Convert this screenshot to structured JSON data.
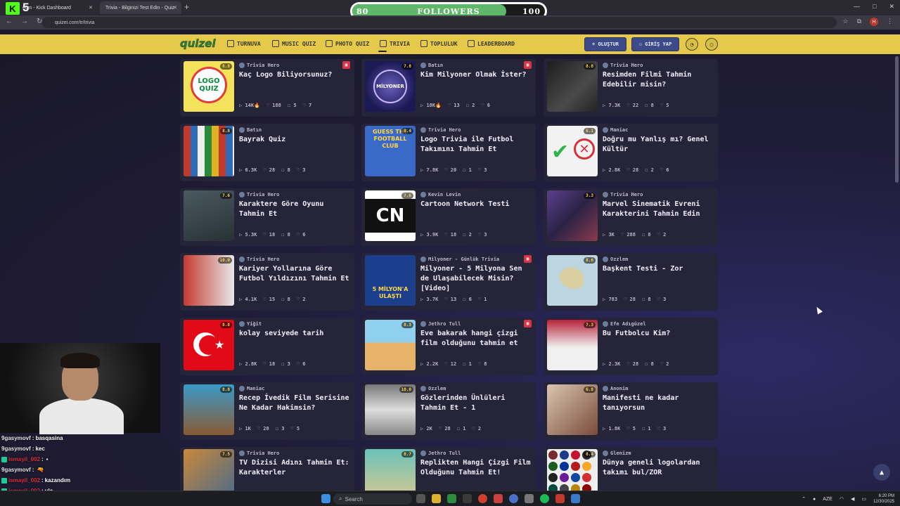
{
  "browser": {
    "tabs": [
      {
        "title": "Kick Dashboard",
        "prefix": "com - "
      },
      {
        "title": "Trivia - Bilginizi Test Edin - Quiz"
      }
    ],
    "new_tab": "+",
    "url": "quizei.com/tr/trivia",
    "profile_initial": "H",
    "window_controls": [
      "—",
      "□",
      "✕"
    ]
  },
  "overlay": {
    "kick_count": "5",
    "followers_label": "FOLLOWERS",
    "followers_current": "80",
    "followers_goal": "100",
    "followers_progress": 0.8
  },
  "site": {
    "logo": "quizei",
    "nav": [
      {
        "label": "TURNUVA",
        "icon": "trophy-icon"
      },
      {
        "label": "MUSIC QUIZ",
        "icon": "music-icon"
      },
      {
        "label": "PHOTO QUIZ",
        "icon": "photo-icon"
      },
      {
        "label": "TRIVIA",
        "icon": "lightbulb-icon"
      },
      {
        "label": "TOPLULUK",
        "icon": "users-icon"
      },
      {
        "label": "LEADERBOARD",
        "icon": "medal-icon"
      }
    ],
    "create_label": "+ OLUŞTUR",
    "login_label": "GİRİŞ YAP"
  },
  "cards": [
    {
      "author": "Trivia Hero",
      "title": "Kaç Logo Biliyorsunuz?",
      "rating": "8.8",
      "stats": [
        "14K",
        "188",
        "5",
        "7"
      ],
      "hot": true,
      "badge": true,
      "thumb_text": "LOGO QUIZ"
    },
    {
      "author": "Batın",
      "title": "Kim Milyoner Olmak İster?",
      "rating": "7.8",
      "stats": [
        "18K",
        "13",
        "2",
        "6"
      ],
      "hot": true,
      "badge": true,
      "thumb_text": "MİLYONER"
    },
    {
      "author": "Trivia Hero",
      "title": "Resimden Filmi Tahmin Edebilir misin?",
      "rating": "8.8",
      "stats": [
        "7.3K",
        "22",
        "8",
        "5"
      ],
      "hot": false,
      "badge": false
    },
    {
      "author": "Batın",
      "title": "Bayrak Quiz",
      "rating": "8.8",
      "stats": [
        "6.3K",
        "28",
        "8",
        "3"
      ],
      "hot": false,
      "badge": false
    },
    {
      "author": "Trivia Hero",
      "title": "Logo Trivia ile Futbol Takımını Tahmin Et",
      "rating": "8.4",
      "stats": [
        "7.8K",
        "20",
        "1",
        "3"
      ],
      "hot": false,
      "badge": false,
      "thumb_text": "GUESS THE FOOTBALL CLUB"
    },
    {
      "author": "Maniac",
      "title": "Doğru mu Yanlış mı? Genel Kültür",
      "rating": "6.1",
      "stats": [
        "2.8K",
        "28",
        "2",
        "6"
      ],
      "hot": false,
      "badge": false
    },
    {
      "author": "Trivia Hero",
      "title": "Karaktere Göre Oyunu Tahmin Et",
      "rating": "7.6",
      "stats": [
        "5.3K",
        "18",
        "8",
        "6"
      ],
      "hot": false,
      "badge": false
    },
    {
      "author": "Kevin Levin",
      "title": "Cartoon Network Testi",
      "rating": "7.6",
      "stats": [
        "3.9K",
        "18",
        "2",
        "3"
      ],
      "hot": false,
      "badge": false,
      "thumb_text": "CN"
    },
    {
      "author": "Trivia Hero",
      "title": "Marvel Sinematik Evreni Karakterini Tahmin Edin",
      "rating": "3.3",
      "stats": [
        "3K",
        "288",
        "8",
        "2"
      ],
      "hot": false,
      "badge": false
    },
    {
      "author": "Trivia Hero",
      "title": "Kariyer Yollarına Göre Futbol Yıldızını Tahmin Et",
      "rating": "10.0",
      "stats": [
        "4.1K",
        "15",
        "8",
        "2"
      ],
      "hot": false,
      "badge": false
    },
    {
      "author": "Milyoner - Günlük Trivia",
      "title": "Milyoner - 5 Milyona Sen de Ulaşabilecek Misin? [Video]",
      "rating": "",
      "stats": [
        "3.7K",
        "13",
        "6",
        "1"
      ],
      "hot": false,
      "badge": true,
      "thumb_text": "5 MİLYON'A ULAŞTI"
    },
    {
      "author": "Ozzlem",
      "title": "Başkent Testi - Zor",
      "rating": "8.6",
      "stats": [
        "783",
        "28",
        "8",
        "3"
      ],
      "hot": false,
      "badge": false
    },
    {
      "author": "Yiğit",
      "title": "kolay seviyede tarih",
      "rating": "8.8",
      "stats": [
        "2.8K",
        "18",
        "3",
        "6"
      ],
      "hot": false,
      "badge": false
    },
    {
      "author": "Jethro Tull",
      "title": "Eve bakarak hangi çizgi film olduğunu tahmin et",
      "rating": "8.3",
      "stats": [
        "2.2K",
        "12",
        "1",
        "8"
      ],
      "hot": false,
      "badge": true
    },
    {
      "author": "Efe Adıgüzel",
      "title": "Bu Futbolcu Kim?",
      "rating": "7.3",
      "stats": [
        "2.3K",
        "28",
        "8",
        "2"
      ],
      "hot": false,
      "badge": false
    },
    {
      "author": "Maniac",
      "title": "Recep İvedik Film Serisine Ne Kadar Hakimsin?",
      "rating": "8.8",
      "stats": [
        "1K",
        "28",
        "3",
        "5"
      ],
      "hot": false,
      "badge": false
    },
    {
      "author": "Ozzlem",
      "title": "Gözlerinden Ünlüleri Tahmin Et - 1",
      "rating": "10.0",
      "stats": [
        "2K",
        "28",
        "1",
        "2"
      ],
      "hot": false,
      "badge": false
    },
    {
      "author": "Anonim",
      "title": "Manifesti ne kadar tanıyorsun",
      "rating": "6.8",
      "stats": [
        "1.8K",
        "5",
        "1",
        "3"
      ],
      "hot": false,
      "badge": false
    },
    {
      "author": "Trivia Hero",
      "title": "TV Dizisi Adını Tahmin Et: Karakterler",
      "rating": "7.5",
      "stats": [],
      "hot": false,
      "badge": false
    },
    {
      "author": "Jethro Tull",
      "title": "Replikten Hangi Çizgi Film Olduğunu Tahmin Et!",
      "rating": "8.7",
      "stats": [],
      "hot": false,
      "badge": false
    },
    {
      "author": "Glenizm",
      "title": "Dünya geneli logolardan takımı bul/ZOR",
      "rating": "8.4",
      "stats": [],
      "hot": false,
      "badge": false
    }
  ],
  "chat": [
    {
      "user": "9gasymovf",
      "msg": "basqasina",
      "red": false
    },
    {
      "user": "9gasymovf",
      "msg": "kec",
      "red": false
    },
    {
      "user": "ismayil_002",
      "msg": "",
      "red": true,
      "emote": "▪"
    },
    {
      "user": "9gasymovf",
      "msg": "",
      "red": false,
      "emote": "🔫"
    },
    {
      "user": "ismayil_002",
      "msg": "kazandım",
      "red": true
    },
    {
      "user": "ismayil_002",
      "msg": "ula",
      "red": true
    },
    {
      "user": "ismayil_002",
      "msg": "",
      "red": true,
      "emote": "🔫"
    }
  ],
  "taskbar": {
    "search_placeholder": "Search",
    "language": "AZE",
    "time": "6:20 PM",
    "date": "12/30/2025"
  }
}
